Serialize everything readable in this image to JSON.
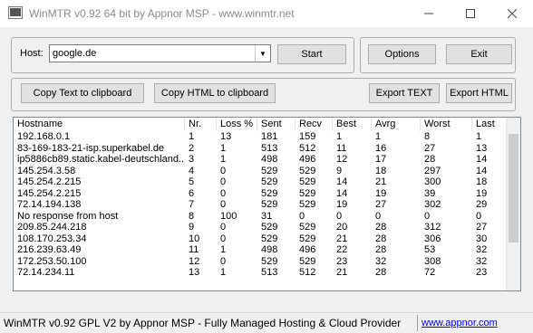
{
  "window": {
    "title": "WinMTR v0.92 64 bit by Appnor MSP - www.winmtr.net"
  },
  "host": {
    "label": "Host:",
    "value": "google.de"
  },
  "buttons": {
    "start": "Start",
    "options": "Options",
    "exit": "Exit",
    "copy_text": "Copy Text to clipboard",
    "copy_html": "Copy HTML to clipboard",
    "export_text": "Export TEXT",
    "export_html": "Export HTML"
  },
  "table": {
    "columns": [
      "Hostname",
      "Nr.",
      "Loss %",
      "Sent",
      "Recv",
      "Best",
      "Avrg",
      "Worst",
      "Last"
    ],
    "rows": [
      [
        "192.168.0.1",
        "1",
        "13",
        "181",
        "159",
        "1",
        "1",
        "8",
        "1"
      ],
      [
        "83-169-183-21-isp.superkabel.de",
        "2",
        "1",
        "513",
        "512",
        "11",
        "16",
        "27",
        "13"
      ],
      [
        "ip5886cb89.static.kabel-deutschland...",
        "3",
        "1",
        "498",
        "496",
        "12",
        "17",
        "28",
        "14"
      ],
      [
        "145.254.3.58",
        "4",
        "0",
        "529",
        "529",
        "9",
        "18",
        "297",
        "14"
      ],
      [
        "145.254.2.215",
        "5",
        "0",
        "529",
        "529",
        "14",
        "21",
        "300",
        "18"
      ],
      [
        "145.254.2.215",
        "6",
        "0",
        "529",
        "529",
        "14",
        "19",
        "39",
        "19"
      ],
      [
        "72.14.194.138",
        "7",
        "0",
        "529",
        "529",
        "19",
        "27",
        "302",
        "29"
      ],
      [
        "No response from host",
        "8",
        "100",
        "31",
        "0",
        "0",
        "0",
        "0",
        "0"
      ],
      [
        "209.85.244.218",
        "9",
        "0",
        "529",
        "529",
        "20",
        "28",
        "312",
        "27"
      ],
      [
        "108.170.253.34",
        "10",
        "0",
        "529",
        "529",
        "21",
        "28",
        "306",
        "30"
      ],
      [
        "216.239.63.49",
        "11",
        "1",
        "498",
        "496",
        "22",
        "28",
        "53",
        "32"
      ],
      [
        "172.253.50.100",
        "12",
        "0",
        "529",
        "529",
        "23",
        "32",
        "308",
        "32"
      ],
      [
        "72.14.234.11",
        "13",
        "1",
        "513",
        "512",
        "21",
        "28",
        "72",
        "23"
      ]
    ]
  },
  "status": {
    "text": "WinMTR v0.92 GPL V2 by Appnor MSP - Fully Managed Hosting & Cloud Provider",
    "link": "www.appnor.com"
  }
}
